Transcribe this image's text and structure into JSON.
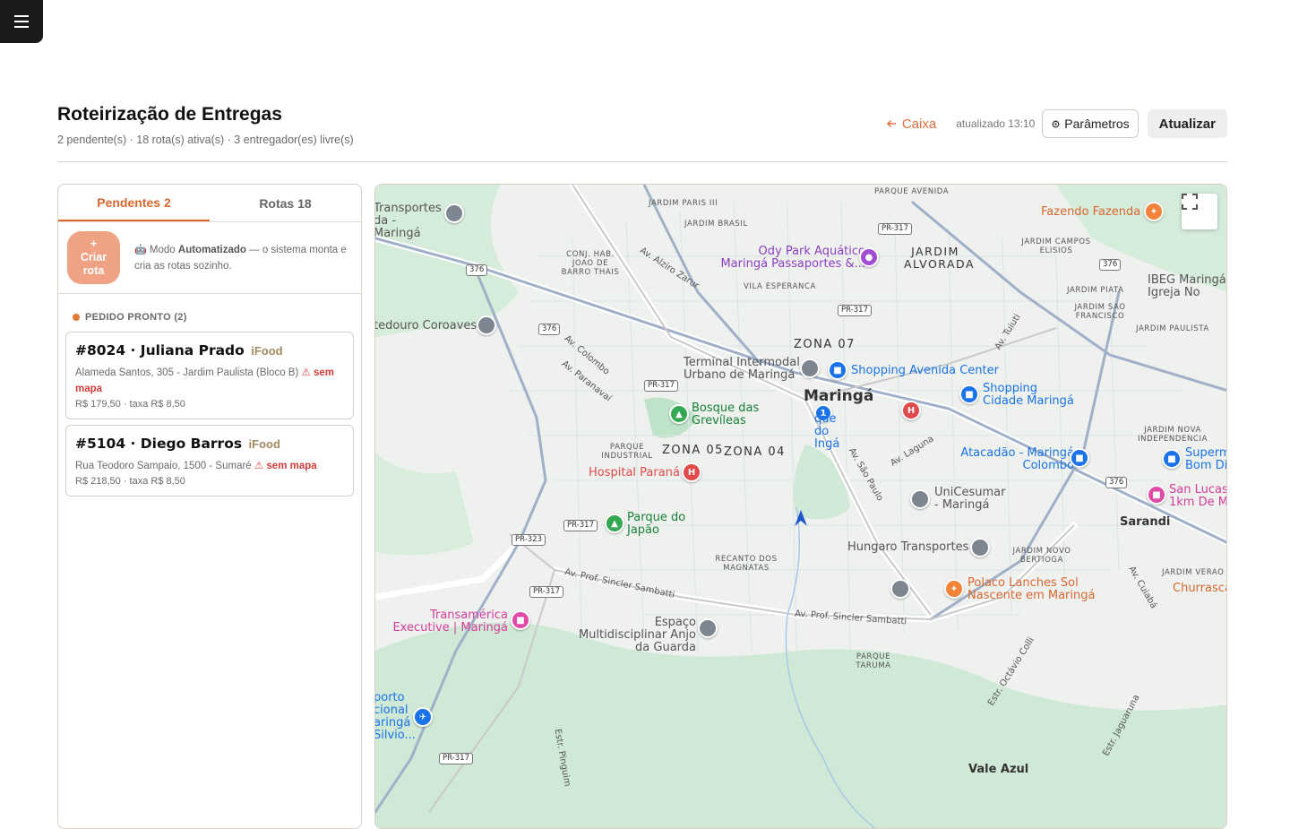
{
  "menu": {
    "icon": "hamburger-menu-icon"
  },
  "header": {
    "title": "Roteirização de Entregas",
    "subtitle": "2 pendente(s) · 18 rota(s) ativa(s) · 3 entregador(es) livre(s)",
    "caixa_label": "Caixa",
    "updated_label": "atualizado 13:10",
    "params_label": "Parâmetros",
    "refresh_label": "Atualizar"
  },
  "tabs": [
    {
      "label": "Pendentes 2",
      "active": true
    },
    {
      "label": "Rotas 18",
      "active": false
    }
  ],
  "auto_mode": {
    "create_icon": "+",
    "create_label_1": "Criar",
    "create_label_2": "rota",
    "prefix": "Modo",
    "mode_name": "Automatizado",
    "description": "— o sistema monta e cria as rotas sozinho."
  },
  "section": {
    "label": "PEDIDO PRONTO (2)"
  },
  "orders": [
    {
      "title": "#8024 · Juliana Prado",
      "source": "iFood",
      "address": "Alameda Santos, 305 - Jardim Paulista (Bloco B)",
      "warning": "sem mapa",
      "price": "R$ 179,50 · taxa R$ 8,50"
    },
    {
      "title": "#5104 · Diego Barros",
      "source": "iFood",
      "address": "Rua Teodoro Sampaio, 1500 - Sumaré",
      "warning": "sem mapa",
      "price": "R$ 218,50 · taxa R$ 8,50"
    }
  ],
  "map": {
    "city": "Maringá",
    "zones": [
      "ZONA 07",
      "ZONA 05",
      "ZONA 04"
    ],
    "areas": [
      "JARDIM PARIS III",
      "JARDIM BRASIL",
      "PARQUE AVENIDA",
      "CONJ. HAB. JOAO DE BARRO THAIS",
      "VILA ESPERANCA",
      "JARDIM ALVORADA",
      "JARDIM CAMPOS ELISIOS",
      "JARDIM PIATA",
      "JARDIM SAO FRANCISCO",
      "JARDIM PAULISTA",
      "PARQUE INDUSTRIAL",
      "JARDIM NOVA INDEPENDENCIA",
      "RECANTO DOS MAGNATAS",
      "JARDIM NOVO BERTIOGA",
      "JARDIM VERAO",
      "PARQUE TARUMA",
      "Sarandi",
      "Vale Azul"
    ],
    "pois": [
      "Transportes da - Maringá",
      "Fazendo Fazenda",
      "Ody Park Aquático Maringá Passaportes &...",
      "IBEG Maringá Igreja No",
      "tedouro Coroaves",
      "Terminal Intermodal Urbano de Maringá",
      "Shopping Avenida Center",
      "Shopping Cidade Maringá",
      "Bosque das Grevíleas",
      "que do Ingá",
      "Hospital Paraná",
      "Atacadão - Maringá Colombo",
      "Superm Bom Di",
      "San Lucas 1km De M",
      "Parque do Japão",
      "UniCesumar - Maringá",
      "Hungaro Transportes",
      "Polaco Lanches Sol Nascente em Maringá",
      "Churrasca",
      "Transamérica Executive | Maringá",
      "Espaço Multidisciplinar Anjo da Guarda",
      "porto cional aringá Silvio..."
    ],
    "roads": [
      "Av. Alziro Zarur",
      "Av. Colombo",
      "Av. Paranavaí",
      "Av. Tuiuti",
      "Av. São Paulo",
      "Av. Laguna",
      "Av. Prof. Sincler Sambatti",
      "Av. Cuiabá",
      "Estr. Octávio Colli",
      "Estr. Jaguaruna",
      "Estr. Pinguim"
    ],
    "shields": [
      "376",
      "PR-317",
      "PR-323"
    ],
    "route_marker": "1"
  }
}
